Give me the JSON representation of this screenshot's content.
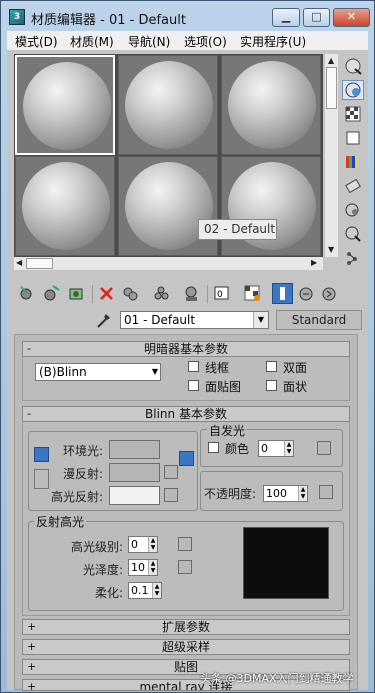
{
  "window": {
    "title": "材质编辑器 - 01 - Default",
    "app_icon_text": "3",
    "min_glyph": "▁",
    "max_glyph": "□",
    "close_glyph": "✕"
  },
  "menu": [
    {
      "label": "模式(D)"
    },
    {
      "label": "材质(M)"
    },
    {
      "label": "导航(N)"
    },
    {
      "label": "选项(O)"
    },
    {
      "label": "实用程序(U)"
    }
  ],
  "preview": {
    "slots": 6,
    "active_slot": 0,
    "tooltip": "02 - Default"
  },
  "sidebar_icons": [
    "sample-type-icon",
    "backlight-icon",
    "background-icon",
    "uv-tiling-icon",
    "video-color-check-icon",
    "make-preview-icon",
    "options-icon",
    "select-by-material-icon",
    "material-map-navigator-icon"
  ],
  "toolbar_icons": [
    "get-material-icon",
    "put-to-scene-icon",
    "assign-to-selection-icon",
    "reset-map-icon",
    "make-copy-icon",
    "make-unique-icon",
    "put-to-library-icon",
    "material-id-channel-icon",
    "show-in-viewport-icon",
    "show-end-result-icon",
    "go-to-parent-icon",
    "go-forward-icon"
  ],
  "material": {
    "name": "01 - Default",
    "type_button": "Standard"
  },
  "shader_basic": {
    "header": "明暗器基本参数",
    "collapse_sign": "-",
    "shader": "(B)Blinn",
    "wire": "线框",
    "two_sided": "双面",
    "face_map": "面贴图",
    "faceted": "面状"
  },
  "blinn_basic": {
    "header": "Blinn 基本参数",
    "collapse_sign": "-",
    "ambient": "环境光:",
    "diffuse": "漫反射:",
    "specular": "高光反射:",
    "self_illum_title": "自发光",
    "color_label": "颜色",
    "self_illum_value": "0",
    "opacity_label": "不透明度:",
    "opacity_value": "100"
  },
  "specular_highlights": {
    "title": "反射高光",
    "level_label": "高光级别:",
    "level_value": "0",
    "gloss_label": "光泽度:",
    "gloss_value": "10",
    "soften_label": "柔化:",
    "soften_value": "0.1"
  },
  "rollouts_collapsed": [
    {
      "sign": "+",
      "label": "扩展参数"
    },
    {
      "sign": "+",
      "label": "超级采样"
    },
    {
      "sign": "+",
      "label": "贴图"
    },
    {
      "sign": "+",
      "label": "mental ray 连接"
    }
  ],
  "watermark": "头条 @3DMAX入门到精通教学",
  "colors": {
    "ambient_swatch": "#b5b5b5",
    "diffuse_swatch": "#b5b5b5",
    "specular_swatch": "#f2f2f2",
    "active_blue": "#3a76c2"
  }
}
